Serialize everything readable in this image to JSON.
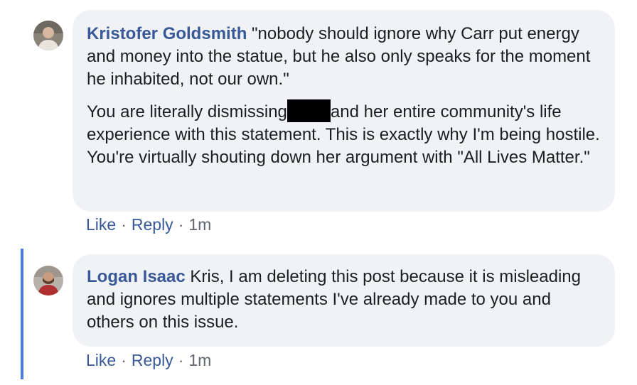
{
  "comments": [
    {
      "author": "Kristofer Goldsmith",
      "avatar_icon": "user-avatar-icon",
      "para1": " \"nobody should ignore why Carr put energy and money into the statue, but he also only speaks for the moment he inhabited, not our own.\"",
      "para2_before": "You are literally dismissing",
      "para2_after": "and her entire community's life experience with this statement. This is exactly why I'm being hostile. You're virtually shouting down her argument with \"All Lives Matter.\"",
      "like_label": "Like",
      "reply_label": "Reply",
      "time": "1m"
    },
    {
      "author": "Logan Isaac",
      "avatar_icon": "user-avatar-icon",
      "text": " Kris, I am deleting this post because it is misleading and ignores multiple statements I've already made to you and others on this issue.",
      "like_label": "Like",
      "reply_label": "Reply",
      "time": "1m"
    }
  ],
  "separator": "·",
  "colors": {
    "name_link": "#385898",
    "bubble_bg": "#f0f2f5",
    "meta_text": "#606770",
    "reply_thread_line": "#4a7be0",
    "redaction": "#000000"
  }
}
